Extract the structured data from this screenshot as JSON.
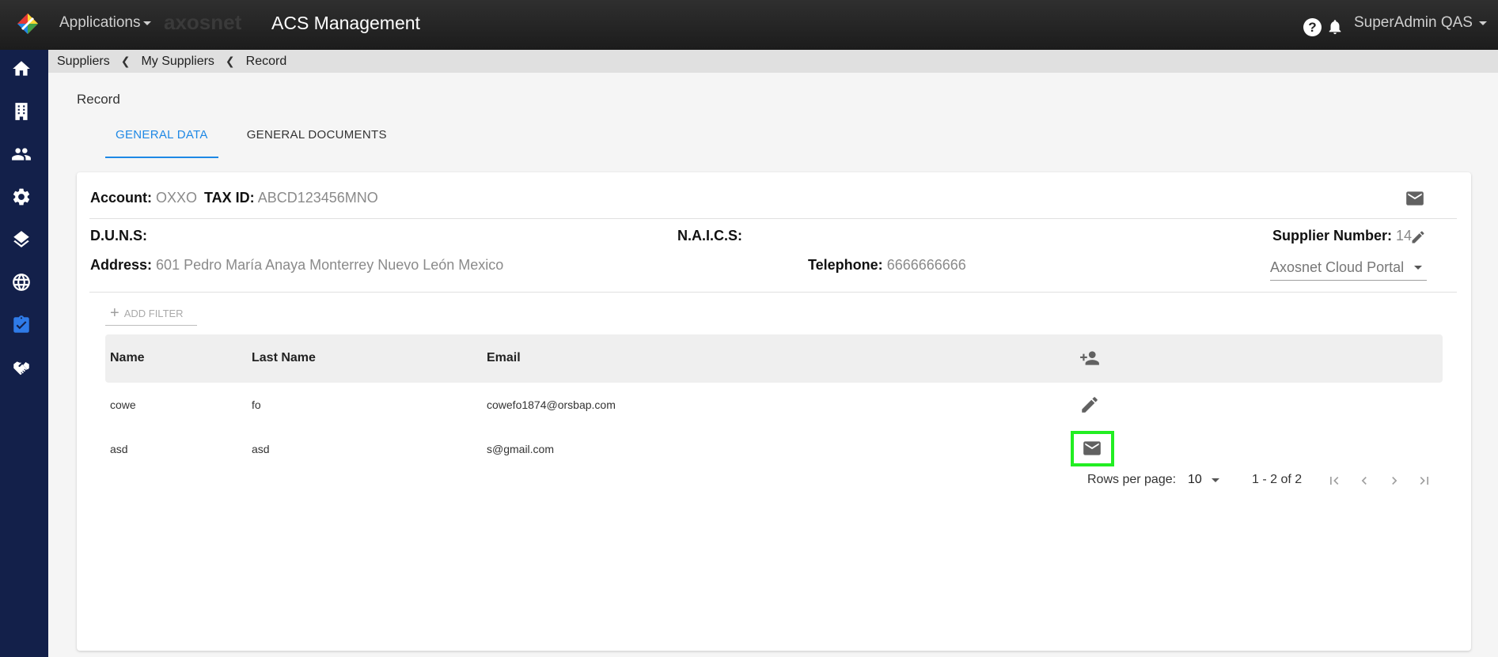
{
  "header": {
    "apps_label": "Applications",
    "brand": "axosnet",
    "title": "ACS Management",
    "user": "SuperAdmin QAS"
  },
  "breadcrumb": [
    "Suppliers",
    "My Suppliers",
    "Record"
  ],
  "page_title": "Record",
  "tabs": [
    "GENERAL DATA",
    "GENERAL DOCUMENTS"
  ],
  "supplier": {
    "account_label": "Account:",
    "account": "OXXO",
    "taxid_label": "TAX ID:",
    "taxid": "ABCD123456MNO",
    "duns_label": "D.U.N.S:",
    "naics_label": "N.A.I.C.S:",
    "supnum_label": "Supplier Number:",
    "supnum": "14",
    "address_label": "Address:",
    "address": "601 Pedro María Anaya Monterrey Nuevo León Mexico",
    "phone_label": "Telephone:",
    "phone": "6666666666",
    "portal": "Axosnet Cloud Portal"
  },
  "filter": {
    "add_label": "ADD FILTER"
  },
  "table": {
    "headers": [
      "Name",
      "Last Name",
      "Email"
    ],
    "rows": [
      {
        "name": "cowe",
        "last": "fo",
        "email": "cowefo1874@orsbap.com",
        "action_icon": "pencil-icon"
      },
      {
        "name": "asd",
        "last": "asd",
        "email": "s@gmail.com",
        "action_icon": "mail-icon"
      }
    ]
  },
  "pagination": {
    "rows_label": "Rows per page:",
    "rows_value": "10",
    "range": "1 - 2 of 2"
  },
  "colors": {
    "accent": "#1e88e5",
    "sidebar": "#13204a",
    "highlight": "#22ee22"
  }
}
